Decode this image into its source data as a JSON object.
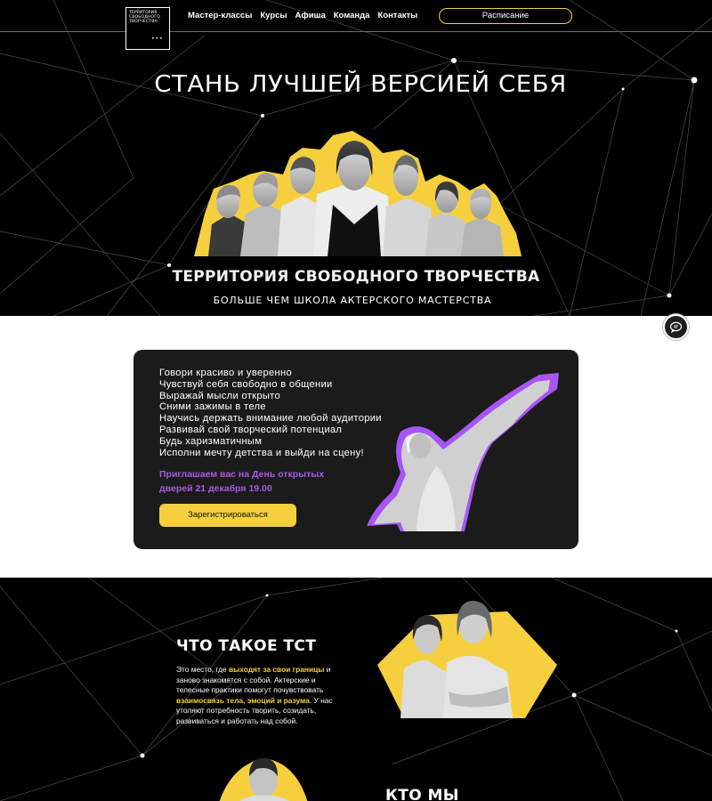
{
  "header": {
    "logo_lines": [
      "ТЕРРИТОРИЯ",
      "СВОБОДНОГО",
      "ТВОРЧЕСТВА"
    ],
    "logo_dots": "•••",
    "nav": [
      "Мастер-классы",
      "Курсы",
      "Афиша",
      "Команда",
      "Контакты"
    ],
    "schedule_label": "Расписание"
  },
  "hero": {
    "title": "СТАНЬ ЛУЧШЕЙ ВЕРСИЕЙ СЕБЯ",
    "subtitle": "ТЕРРИТОРИЯ СВОБОДНОГО ТВОРЧЕСТВА",
    "tagline": "БОЛЬШЕ ЧЕМ ШКОЛА АКТЕРСКОГО МАСТЕРСТВА"
  },
  "benefits": {
    "items": [
      "Говори красиво и уверенно",
      "Чувствуй себя свободно в общении",
      "Выражай мысли открыто",
      "Сними зажимы в теле",
      "Научись держать внимание любой аудитории",
      "Развивай свой творческий потенциал",
      "Будь харизматичным",
      "Исполни мечту детства и выйди на сцену!"
    ],
    "invite_line1": "Приглашаем вас на День открытых",
    "invite_line2": "дверей 21 декабря 19.00",
    "register_label": "Зарегистрироваться"
  },
  "about": {
    "title": "ЧТО ТАКОЕ ТСТ",
    "text_parts": [
      "Это место, где ",
      "выходят за свои границы",
      " и заново знакомятся с собой. Актерские и телесные практики помогут почувствовать ",
      "взаимосвязь тела, эмоций и разума",
      ". У нас утоляют потребность творить, созидать, развиваться и работать над собой."
    ]
  },
  "team": {
    "title": "КТО МЫ"
  },
  "icons": {
    "chat": "chat-bubble-icon",
    "network": "constellation-background"
  },
  "colors": {
    "accent_yellow": "#f6cf3e",
    "accent_purple": "#a55ae0",
    "background": "#000000",
    "card": "#1b1b1b"
  }
}
